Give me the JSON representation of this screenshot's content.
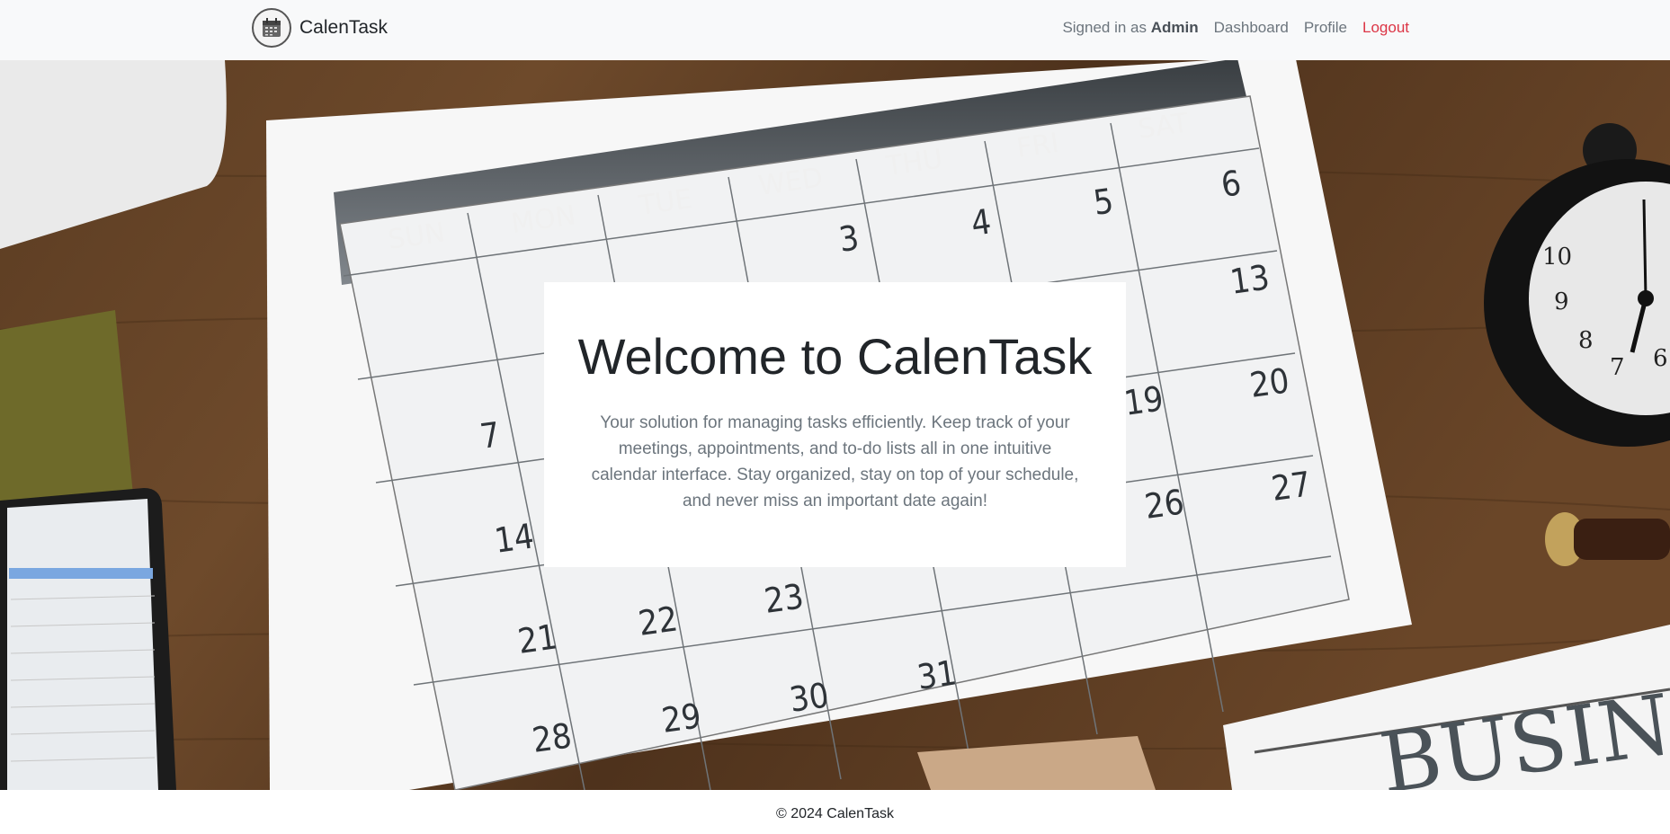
{
  "brand": {
    "name": "CalenTask",
    "logo_icon": "calendar-icon"
  },
  "nav": {
    "signed_in_prefix": "Signed in as",
    "user": "Admin",
    "dashboard": "Dashboard",
    "profile": "Profile",
    "logout": "Logout"
  },
  "hero": {
    "title": "Welcome to CalenTask",
    "description": "Your solution for managing tasks efficiently. Keep track of your meetings, appointments, and to-do lists all in one intuitive calendar interface. Stay organized, stay on top of your schedule, and never miss an important date again!",
    "image": {
      "weekdays": [
        "SUN",
        "MON",
        "TUE",
        "WED",
        "THU",
        "FRI",
        "SAT"
      ],
      "paper_title": "BUSINE"
    }
  },
  "footer": {
    "copyright": "© 2024 CalenTask"
  },
  "colors": {
    "navbar_bg": "#f8f9fa",
    "logout": "#dc3545",
    "muted": "#6c757d",
    "desk": "#5a3d25"
  }
}
